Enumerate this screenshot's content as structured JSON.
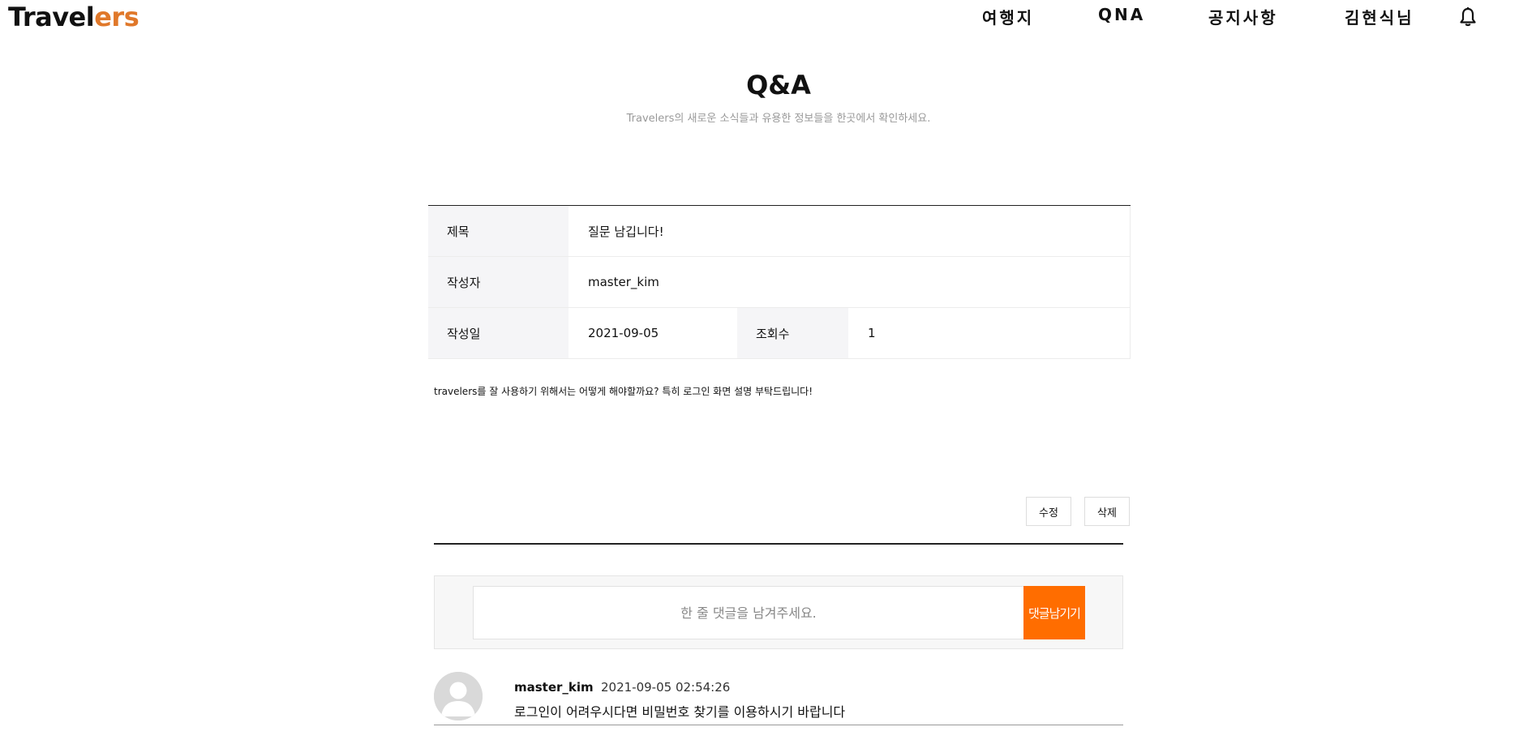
{
  "header": {
    "logo_part1": "Travel",
    "logo_part2": "ers",
    "nav": [
      "여행지",
      "QNA",
      "공지사항",
      "김현식님"
    ],
    "bell_icon": "bell-icon"
  },
  "page": {
    "title": "Q&A",
    "subtitle": "Travelers의 새로운 소식들과 유용한 정보들을 한곳에서 확인하세요."
  },
  "post": {
    "title_label": "제목",
    "title_value": "질문 남깁니다!",
    "author_label": "작성자",
    "author_value": "master_kim",
    "date_label": "작성일",
    "date_value": "2021-09-05",
    "views_label": "조회수",
    "views_value": "1",
    "content": "travelers를 잘 사용하기 위해서는 어떻게 해야할까요? 특히 로그인 화면 설명 부탁드립니다!"
  },
  "actions": {
    "edit_label": "수정",
    "delete_label": "삭제"
  },
  "comment_form": {
    "placeholder": "한 줄 댓글을 남겨주세요.",
    "submit_label": "댓글남기기"
  },
  "comments": [
    {
      "author": "master_kim",
      "date": "2021-09-05 02:54:26",
      "text": "로그인이 어려우시다면 비밀번호 찾기를 이용하시기 바랍니다"
    }
  ],
  "colors": {
    "accent": "#ff6d00",
    "logo_accent": "#e0782a"
  }
}
